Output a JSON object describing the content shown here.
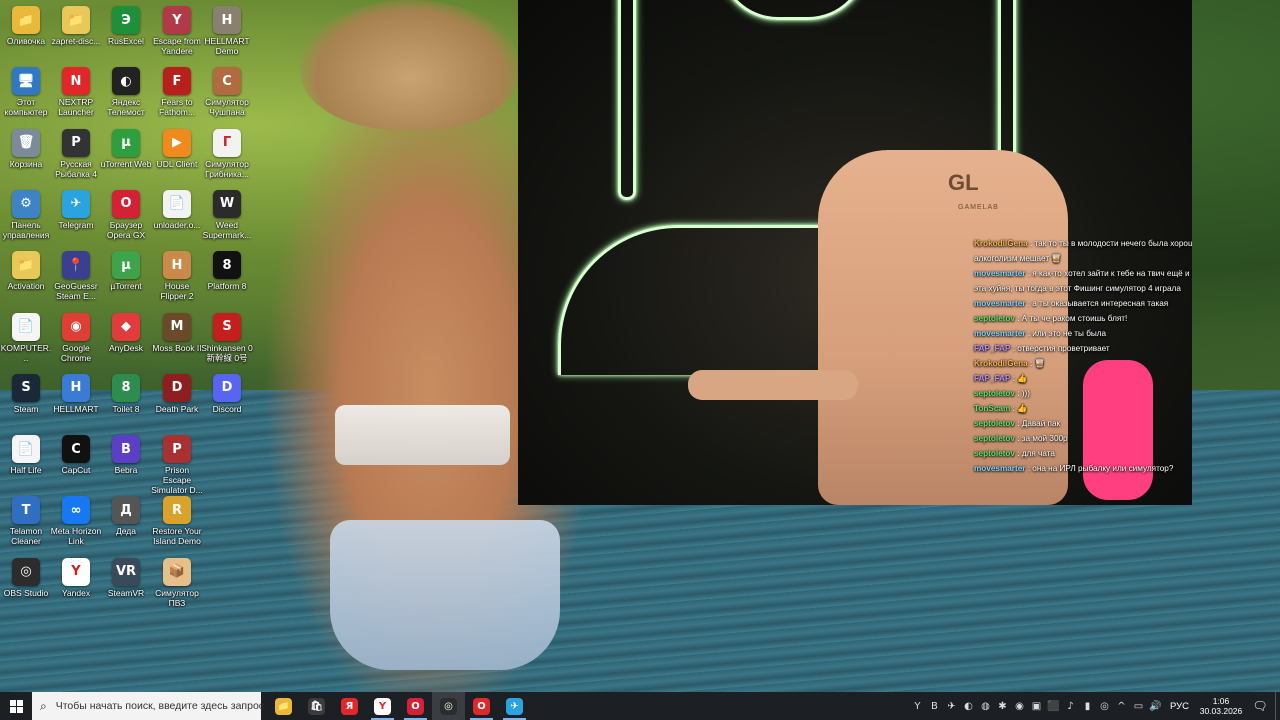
{
  "desktop": {
    "icons": [
      {
        "label": "Оливочка",
        "glyph": "📁",
        "color": "#e9b93a"
      },
      {
        "label": "zapret-disc...",
        "glyph": "📁",
        "color": "#e9c85a"
      },
      {
        "label": "RusExcel",
        "glyph": "Э",
        "color": "#1f8f3a"
      },
      {
        "label": "Escape from Yandere",
        "glyph": "Y",
        "color": "#b23a48"
      },
      {
        "label": "HELLMART Demo",
        "glyph": "H",
        "color": "#8a8070"
      },
      {
        "label": "Этот компьютер",
        "glyph": "🖥",
        "color": "#2f78c4"
      },
      {
        "label": "NEXTRP Launcher",
        "glyph": "N",
        "color": "#e0282a"
      },
      {
        "label": "Яндекс Телемост",
        "glyph": "◐",
        "color": "#222222"
      },
      {
        "label": "Fears to Fathom...",
        "glyph": "F",
        "color": "#b8201e"
      },
      {
        "label": "Симулятор Чушпана",
        "glyph": "С",
        "color": "#b06c40"
      },
      {
        "label": "Корзина",
        "glyph": "🗑",
        "color": "#7c8b99"
      },
      {
        "label": "Русская Рыбалка 4",
        "glyph": "Р",
        "color": "#333333"
      },
      {
        "label": "uTorrent Web",
        "glyph": "µ",
        "color": "#2f9e3f"
      },
      {
        "label": "UDL Client",
        "glyph": "▶",
        "color": "#f08a1c"
      },
      {
        "label": "Симулятор Грибника...",
        "glyph": "Г",
        "color": "#f2f2f2"
      },
      {
        "label": "Панель управления",
        "glyph": "⚙",
        "color": "#3d84c6"
      },
      {
        "label": "Telegram",
        "glyph": "✈",
        "color": "#2aa3df"
      },
      {
        "label": "Браузер Opera GX",
        "glyph": "O",
        "color": "#d32135"
      },
      {
        "label": "unloader.o...",
        "glyph": "📄",
        "color": "#f2f2f2"
      },
      {
        "label": "Weed Supermark...",
        "glyph": "W",
        "color": "#2b2b2b"
      },
      {
        "label": "Activation",
        "glyph": "📁",
        "color": "#e9c85a"
      },
      {
        "label": "GeoGuessr Steam E...",
        "glyph": "📍",
        "color": "#3b3f8f"
      },
      {
        "label": "µTorrent",
        "glyph": "µ",
        "color": "#3ea34a"
      },
      {
        "label": "House Flipper 2",
        "glyph": "H",
        "color": "#c98a4a"
      },
      {
        "label": "Platform 8",
        "glyph": "8",
        "color": "#111111"
      },
      {
        "label": "KOMPUTER...",
        "glyph": "📄",
        "color": "#f5f5f5"
      },
      {
        "label": "Google Chrome",
        "glyph": "◉",
        "color": "#de3e33"
      },
      {
        "label": "AnyDesk",
        "glyph": "◆",
        "color": "#e23b3b"
      },
      {
        "label": "Moss Book II",
        "glyph": "M",
        "color": "#6b4a2a"
      },
      {
        "label": "Shinkansen 0 新幹線 0号",
        "glyph": "S",
        "color": "#c41e1e"
      },
      {
        "label": "Steam",
        "glyph": "S",
        "color": "#1b2838"
      },
      {
        "label": "HELLMART",
        "glyph": "H",
        "color": "#3a7bd5"
      },
      {
        "label": "Toilet 8",
        "glyph": "8",
        "color": "#2d8c4e"
      },
      {
        "label": "Death Park",
        "glyph": "D",
        "color": "#8f1f1f"
      },
      {
        "label": "Discord",
        "glyph": "D",
        "color": "#5865f2"
      },
      {
        "label": "Half Life",
        "glyph": "📄",
        "color": "#f5f5f5"
      },
      {
        "label": "CapCut",
        "glyph": "C",
        "color": "#111111"
      },
      {
        "label": "Bebra",
        "glyph": "B",
        "color": "#5b3fc4"
      },
      {
        "label": "Prison Escape Simulator D...",
        "glyph": "P",
        "color": "#a83232"
      },
      {
        "label": "",
        "glyph": "",
        "color": "transparent"
      },
      {
        "label": "Telamon Cleaner",
        "glyph": "T",
        "color": "#2f6fc1"
      },
      {
        "label": "Meta Horizon Link",
        "glyph": "∞",
        "color": "#1877f2"
      },
      {
        "label": "Деда",
        "glyph": "Д",
        "color": "#555555"
      },
      {
        "label": "Restore Your Island Demo",
        "glyph": "R",
        "color": "#d9a22a"
      },
      {
        "label": "",
        "glyph": "",
        "color": "transparent"
      },
      {
        "label": "OBS Studio",
        "glyph": "◎",
        "color": "#2c2c2c"
      },
      {
        "label": "Yandex",
        "glyph": "Y",
        "color": "#ffffff"
      },
      {
        "label": "SteamVR",
        "glyph": "VR",
        "color": "#3b4a5a"
      },
      {
        "label": "Симулятор ПВЗ",
        "glyph": "📦",
        "color": "#e6c089"
      },
      {
        "label": "",
        "glyph": "",
        "color": "transparent"
      }
    ]
  },
  "stream": {
    "chair_logo": "GL",
    "chair_brand": "GAMELAB",
    "chat": [
      {
        "user": "KrokodilGena",
        "text": ": так то ты в молодости нечего была хорошая) Ну постарела да и алкоголизм мешает 🥃",
        "color": "#f0b24a"
      },
      {
        "user": "movesmarter",
        "text": ": я как-то хотел зайти к тебе на твич ещё и сказать что рыбалка эта хуйня, ты тогда в этот Фишинг симулятор 4 играла",
        "color": "#7fd3ff"
      },
      {
        "user": "movesmarter",
        "text": ": а ты оказывается интересная такая",
        "color": "#7fd3ff"
      },
      {
        "user": "septoletov",
        "text": ": А ты че раком стоишь блят!",
        "color": "#5be36b"
      },
      {
        "user": "movesmarter",
        "text": ": или это не ты была",
        "color": "#7fd3ff"
      },
      {
        "user": "FAP_FAP",
        "text": ": отверстия проветривает",
        "color": "#b08cff"
      },
      {
        "user": "KrokodilGena",
        "text": ": 🥃",
        "color": "#f0b24a"
      },
      {
        "user": "FAP_FAP",
        "text": ": 👍",
        "color": "#b08cff"
      },
      {
        "user": "septoletov",
        "text": ": )))",
        "color": "#5be36b"
      },
      {
        "user": "TonScam",
        "text": ": 👍",
        "color": "#5be36b"
      },
      {
        "user": "septoletov",
        "text": ": Давай пак",
        "color": "#5be36b"
      },
      {
        "user": "septoletov",
        "text": ": за мой 300р",
        "color": "#5be36b"
      },
      {
        "user": "septoletov",
        "text": ": для чата",
        "color": "#5be36b"
      },
      {
        "user": "movesmarter",
        "text": ": она на ИРЛ рыбалку или симулятор?",
        "color": "#7fd3ff"
      }
    ]
  },
  "taskbar": {
    "search_placeholder": "Чтобы начать поиск, введите здесь запрос",
    "apps": [
      {
        "name": "explorer",
        "glyph": "📁",
        "color": "#e9b93a",
        "state": ""
      },
      {
        "name": "store",
        "glyph": "🛍",
        "color": "#3b3b3b",
        "state": ""
      },
      {
        "name": "yandex-music",
        "glyph": "Я",
        "color": "#e0282a",
        "state": ""
      },
      {
        "name": "yandex-browser",
        "glyph": "Y",
        "color": "#ffffff",
        "state": "active"
      },
      {
        "name": "opera-gx",
        "glyph": "O",
        "color": "#d32135",
        "state": "active"
      },
      {
        "name": "obs",
        "glyph": "◎",
        "color": "#2c2c2c",
        "state": "current"
      },
      {
        "name": "opera",
        "glyph": "O",
        "color": "#e0282a",
        "state": "active"
      },
      {
        "name": "telegram",
        "glyph": "✈",
        "color": "#2aa3df",
        "state": "active"
      }
    ],
    "tray_icons": [
      "Y",
      "B",
      "✈",
      "◐",
      "◍",
      "✱",
      "◉",
      "▣",
      "⬛",
      "♪",
      "▮",
      "◎",
      "^",
      "▭",
      "🔊"
    ],
    "language": "РУС",
    "time": "1:06",
    "date": "30.03.2026",
    "notification_glyph": "🗨"
  }
}
